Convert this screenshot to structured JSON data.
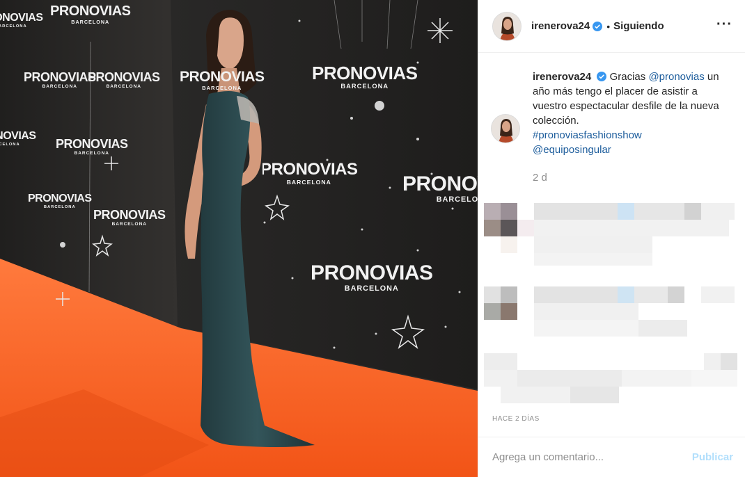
{
  "post": {
    "username": "irenerova24",
    "verified": true,
    "separator": "•",
    "follow_status": "Siguiendo",
    "more_icon": "more-icon"
  },
  "caption": {
    "username": "irenerova24",
    "text_before": "Gracias ",
    "mention_1": "@pronovias",
    "text_after": " un año más tengo el placer de asistir a vuestro espectacular desfile de la nueva colección.",
    "hashtag": "#pronoviasfashionshow",
    "mention_2": "@equiposingular",
    "time_ago": "2 d"
  },
  "photo": {
    "brand_name": "PRONOVIAS",
    "brand_city": "BARCELONA",
    "colors": {
      "carpet": "#ff6a2d",
      "wall": "#2a2928",
      "dress": "#2c474b"
    }
  },
  "footer": {
    "date": "HACE 2 DÍAS",
    "comment_placeholder": "Agrega un comentario...",
    "publish_label": "Publicar"
  },
  "colors": {
    "link": "#1d5d9c",
    "muted": "#8e8e8e",
    "publish_disabled": "#b2dffc"
  }
}
